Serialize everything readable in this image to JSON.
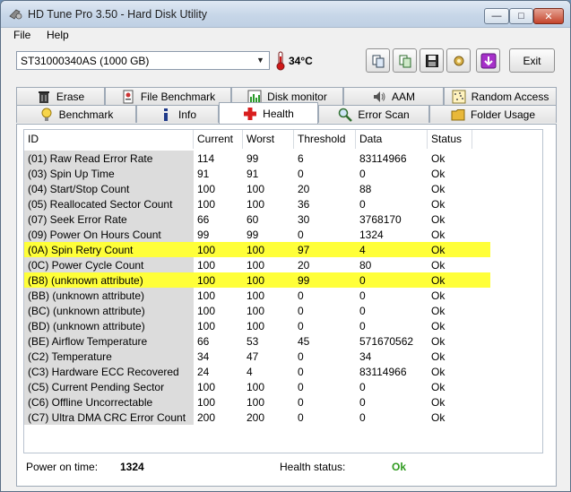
{
  "window": {
    "title": "HD Tune Pro 3.50 - Hard Disk Utility"
  },
  "menu": {
    "file": "File",
    "help": "Help"
  },
  "toolbar": {
    "drive": "ST31000340AS (1000 GB)",
    "temperature": "34°C",
    "exit_label": "Exit"
  },
  "tabs_top": [
    {
      "label": "Erase",
      "icon": "trash-icon"
    },
    {
      "label": "File Benchmark",
      "icon": "file-benchmark-icon"
    },
    {
      "label": "Disk monitor",
      "icon": "disk-monitor-icon"
    },
    {
      "label": "AAM",
      "icon": "speaker-icon"
    },
    {
      "label": "Random Access",
      "icon": "random-access-icon"
    }
  ],
  "tabs_bottom": [
    {
      "label": "Benchmark",
      "icon": "lightbulb-icon"
    },
    {
      "label": "Info",
      "icon": "info-icon"
    },
    {
      "label": "Health",
      "icon": "health-cross-icon",
      "active": true
    },
    {
      "label": "Error Scan",
      "icon": "magnifier-icon"
    },
    {
      "label": "Folder Usage",
      "icon": "folder-icon"
    }
  ],
  "table": {
    "columns": [
      "ID",
      "Current",
      "Worst",
      "Threshold",
      "Data",
      "Status"
    ],
    "rows": [
      {
        "id": "(01) Raw Read Error Rate",
        "current": "114",
        "worst": "99",
        "threshold": "6",
        "data": "83114966",
        "status": "Ok",
        "warn": false
      },
      {
        "id": "(03) Spin Up Time",
        "current": "91",
        "worst": "91",
        "threshold": "0",
        "data": "0",
        "status": "Ok",
        "warn": false
      },
      {
        "id": "(04) Start/Stop Count",
        "current": "100",
        "worst": "100",
        "threshold": "20",
        "data": "88",
        "status": "Ok",
        "warn": false
      },
      {
        "id": "(05) Reallocated Sector Count",
        "current": "100",
        "worst": "100",
        "threshold": "36",
        "data": "0",
        "status": "Ok",
        "warn": false
      },
      {
        "id": "(07) Seek Error Rate",
        "current": "66",
        "worst": "60",
        "threshold": "30",
        "data": "3768170",
        "status": "Ok",
        "warn": false
      },
      {
        "id": "(09) Power On Hours Count",
        "current": "99",
        "worst": "99",
        "threshold": "0",
        "data": "1324",
        "status": "Ok",
        "warn": false
      },
      {
        "id": "(0A) Spin Retry Count",
        "current": "100",
        "worst": "100",
        "threshold": "97",
        "data": "4",
        "status": "Ok",
        "warn": true
      },
      {
        "id": "(0C) Power Cycle Count",
        "current": "100",
        "worst": "100",
        "threshold": "20",
        "data": "80",
        "status": "Ok",
        "warn": false
      },
      {
        "id": "(B8) (unknown attribute)",
        "current": "100",
        "worst": "100",
        "threshold": "99",
        "data": "0",
        "status": "Ok",
        "warn": true
      },
      {
        "id": "(BB) (unknown attribute)",
        "current": "100",
        "worst": "100",
        "threshold": "0",
        "data": "0",
        "status": "Ok",
        "warn": false
      },
      {
        "id": "(BC) (unknown attribute)",
        "current": "100",
        "worst": "100",
        "threshold": "0",
        "data": "0",
        "status": "Ok",
        "warn": false
      },
      {
        "id": "(BD) (unknown attribute)",
        "current": "100",
        "worst": "100",
        "threshold": "0",
        "data": "0",
        "status": "Ok",
        "warn": false
      },
      {
        "id": "(BE) Airflow Temperature",
        "current": "66",
        "worst": "53",
        "threshold": "45",
        "data": "571670562",
        "status": "Ok",
        "warn": false
      },
      {
        "id": "(C2) Temperature",
        "current": "34",
        "worst": "47",
        "threshold": "0",
        "data": "34",
        "status": "Ok",
        "warn": false
      },
      {
        "id": "(C3) Hardware ECC Recovered",
        "current": "24",
        "worst": "4",
        "threshold": "0",
        "data": "83114966",
        "status": "Ok",
        "warn": false
      },
      {
        "id": "(C5) Current Pending Sector",
        "current": "100",
        "worst": "100",
        "threshold": "0",
        "data": "0",
        "status": "Ok",
        "warn": false
      },
      {
        "id": "(C6) Offline Uncorrectable",
        "current": "100",
        "worst": "100",
        "threshold": "0",
        "data": "0",
        "status": "Ok",
        "warn": false
      },
      {
        "id": "(C7) Ultra DMA CRC Error Count",
        "current": "200",
        "worst": "200",
        "threshold": "0",
        "data": "0",
        "status": "Ok",
        "warn": false
      }
    ]
  },
  "footer": {
    "power_on_label": "Power on time:",
    "power_on_value": "1324",
    "health_label": "Health status:",
    "health_value": "Ok"
  },
  "colors": {
    "warn_row": "#ffff39",
    "health_ok": "#2f9a1f"
  }
}
